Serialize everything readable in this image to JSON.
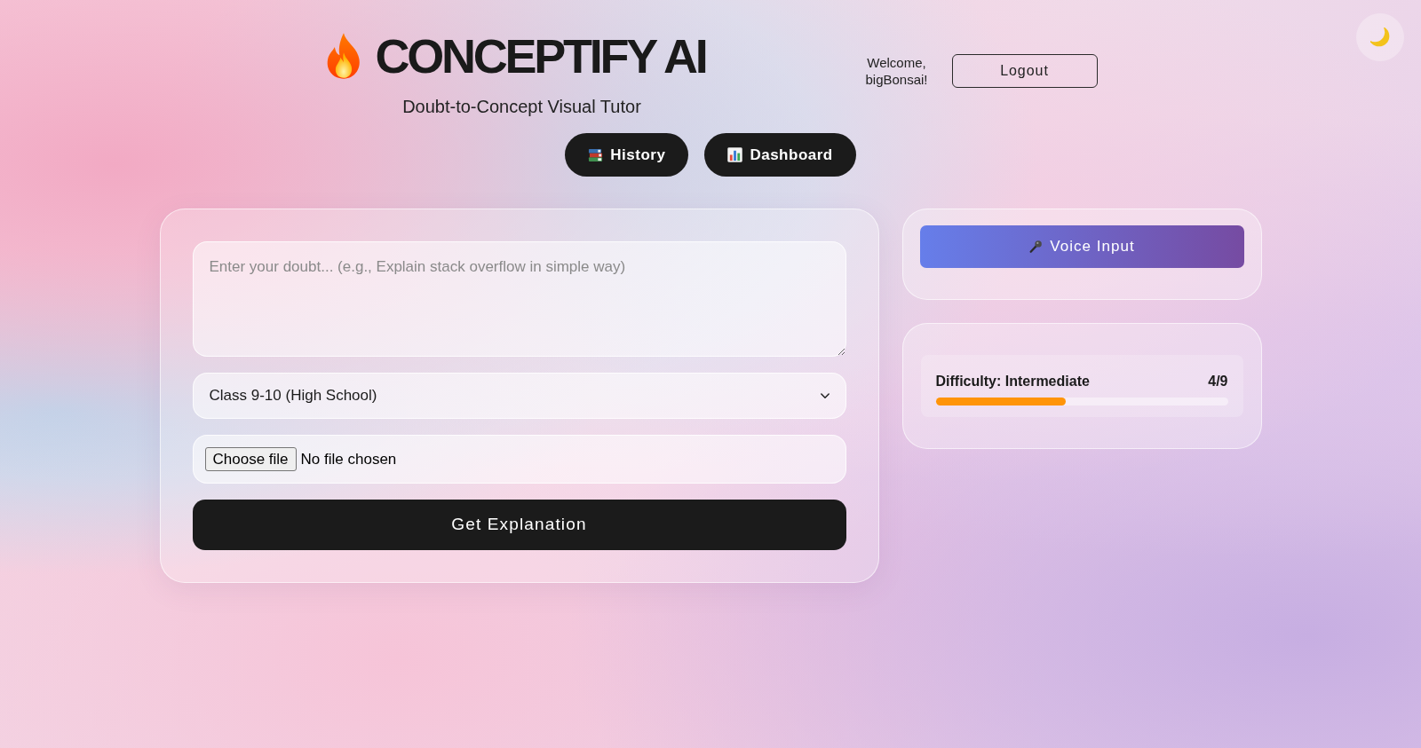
{
  "header": {
    "title": "CONCEPTIFY AI",
    "subtitle": "Doubt-to-Concept Visual Tutor"
  },
  "user": {
    "welcome": "Welcome, bigBonsai!",
    "logout_button": "Logout"
  },
  "nav_buttons": [
    {
      "label": "History",
      "kind": "history"
    },
    {
      "label": "Dashboard",
      "kind": "dashboard"
    }
  ],
  "doubt_form": {
    "doubt_field": {
      "placeholder": "Enter your doubt... (e.g., Explain stack overflow in simple way)"
    },
    "class_select": {
      "value": "Class 9-10 (High School)"
    },
    "file_upload": {
      "button": "Choose file",
      "status": "No file chosen"
    },
    "submit_button": "Get Explanation"
  },
  "voice_input": {
    "button": "Voice Input"
  },
  "difficulty": {
    "label": "Difficulty: Intermediate",
    "score": "4/9",
    "level": 0.444
  }
}
